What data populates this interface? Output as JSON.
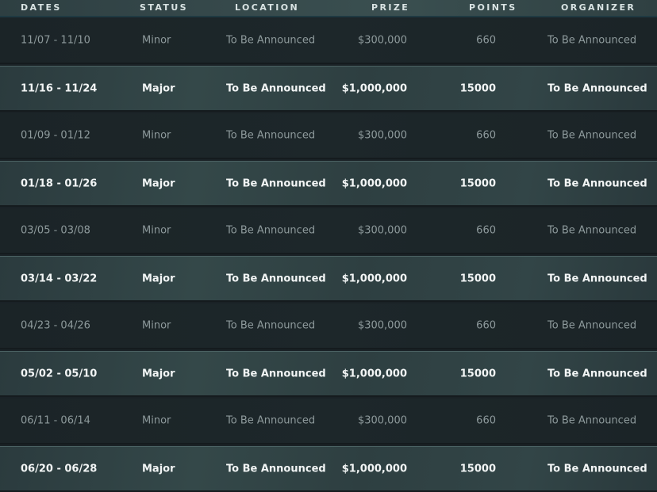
{
  "headers": {
    "dates": "DATES",
    "status": "STATUS",
    "location": "LOCATION",
    "prize": "PRIZE",
    "points": "POINTS",
    "organizer": "ORGANIZER"
  },
  "rows": [
    {
      "type": "minor",
      "dates": "11/07 - 11/10",
      "status": "Minor",
      "location": "To Be Announced",
      "prize": "$300,000",
      "points": "660",
      "organizer": "To Be Announced"
    },
    {
      "type": "major",
      "dates": "11/16 - 11/24",
      "status": "Major",
      "location": "To Be Announced",
      "prize": "$1,000,000",
      "points": "15000",
      "organizer": "To Be Announced"
    },
    {
      "type": "minor",
      "dates": "01/09 - 01/12",
      "status": "Minor",
      "location": "To Be Announced",
      "prize": "$300,000",
      "points": "660",
      "organizer": "To Be Announced"
    },
    {
      "type": "major",
      "dates": "01/18 - 01/26",
      "status": "Major",
      "location": "To Be Announced",
      "prize": "$1,000,000",
      "points": "15000",
      "organizer": "To Be Announced"
    },
    {
      "type": "minor",
      "dates": "03/05 - 03/08",
      "status": "Minor",
      "location": "To Be Announced",
      "prize": "$300,000",
      "points": "660",
      "organizer": "To Be Announced"
    },
    {
      "type": "major",
      "dates": "03/14 - 03/22",
      "status": "Major",
      "location": "To Be Announced",
      "prize": "$1,000,000",
      "points": "15000",
      "organizer": "To Be Announced"
    },
    {
      "type": "minor",
      "dates": "04/23 - 04/26",
      "status": "Minor",
      "location": "To Be Announced",
      "prize": "$300,000",
      "points": "660",
      "organizer": "To Be Announced"
    },
    {
      "type": "major",
      "dates": "05/02 - 05/10",
      "status": "Major",
      "location": "To Be Announced",
      "prize": "$1,000,000",
      "points": "15000",
      "organizer": "To Be Announced"
    },
    {
      "type": "minor",
      "dates": "06/11 - 06/14",
      "status": "Minor",
      "location": "To Be Announced",
      "prize": "$300,000",
      "points": "660",
      "organizer": "To Be Announced"
    },
    {
      "type": "major",
      "dates": "06/20 - 06/28",
      "status": "Major",
      "location": "To Be Announced",
      "prize": "$1,000,000",
      "points": "15000",
      "organizer": "To Be Announced"
    }
  ]
}
